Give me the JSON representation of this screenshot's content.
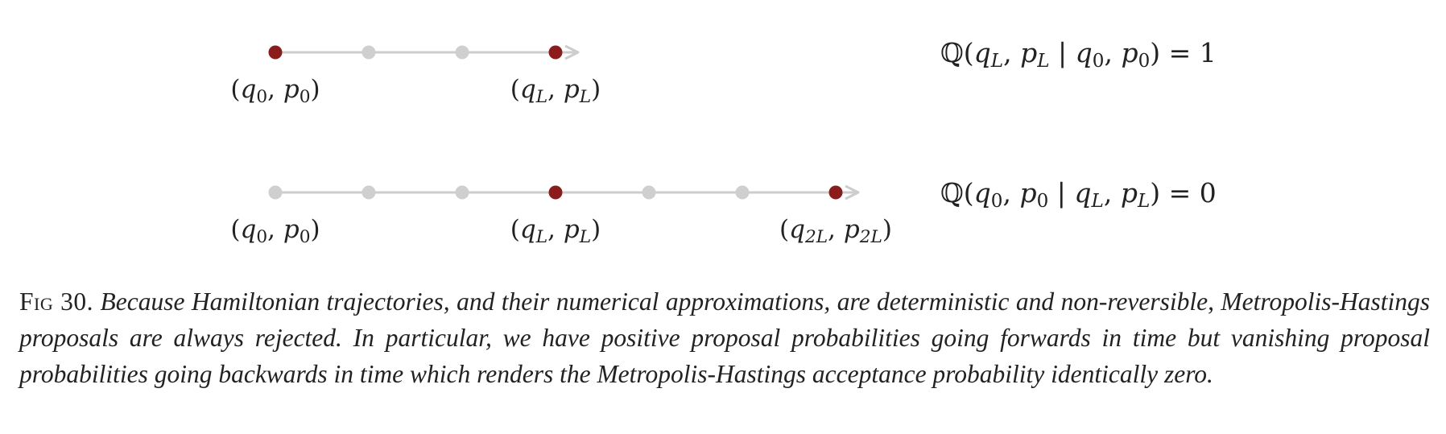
{
  "colors": {
    "active": "#8b1c1c",
    "inactive": "#cfcfcf",
    "line": "#cdcdcd",
    "text": "#222222"
  },
  "rows": [
    {
      "nodes": [
        {
          "state": "active",
          "label": "(q0, p0)"
        },
        {
          "state": "inactive",
          "label": ""
        },
        {
          "state": "inactive",
          "label": ""
        },
        {
          "state": "active",
          "label": "(qL, pL)"
        }
      ],
      "equation": "ℚ(qL, pL | q0, p0) = 1"
    },
    {
      "nodes": [
        {
          "state": "inactive",
          "label": "(q0, p0)"
        },
        {
          "state": "inactive",
          "label": ""
        },
        {
          "state": "inactive",
          "label": ""
        },
        {
          "state": "active",
          "label": "(qL, pL)"
        },
        {
          "state": "inactive",
          "label": ""
        },
        {
          "state": "inactive",
          "label": ""
        },
        {
          "state": "active",
          "label": "(q2L, p2L)"
        }
      ],
      "equation": "ℚ(q0, p0 | qL, pL) = 0"
    }
  ],
  "caption": {
    "label": "Fig 30.",
    "text": "Because Hamiltonian trajectories, and their numerical approximations, are deterministic and non-reversible, Metropolis-Hastings proposals are always rejected. In particular, we have positive proposal probabilities going forwards in time but vanishing proposal probabilities going backwards in time which renders the Metropolis-Hastings acceptance probability identically zero."
  }
}
